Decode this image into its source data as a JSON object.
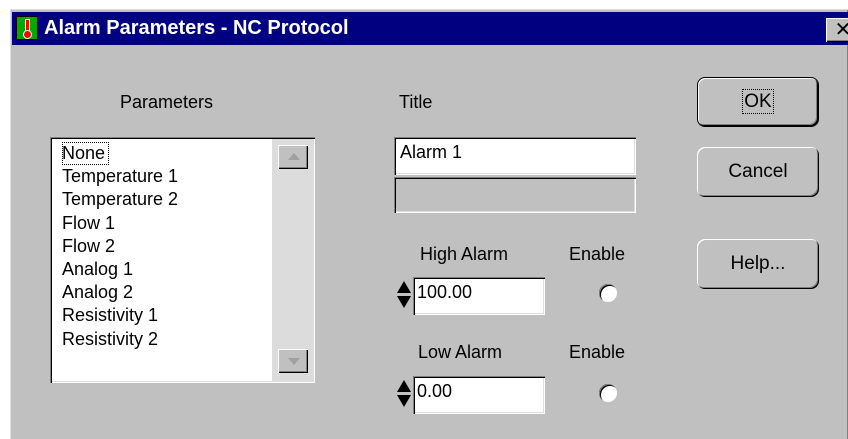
{
  "window": {
    "title": "Alarm Parameters - NC Protocol",
    "close_glyph": "✕"
  },
  "parameters": {
    "label": "Parameters",
    "items": [
      "None",
      "Temperature 1",
      "Temperature 2",
      "Flow 1",
      "Flow 2",
      "Analog 1",
      "Analog 2",
      "Resistivity 1",
      "Resistivity 2"
    ],
    "selected": "None"
  },
  "title_section": {
    "label": "Title",
    "value": "Alarm 1",
    "secondary_value": ""
  },
  "high_alarm": {
    "label": "High Alarm",
    "value": "100.00",
    "enable_label": "Enable",
    "enabled": false
  },
  "low_alarm": {
    "label": "Low Alarm",
    "value": "0.00",
    "enable_label": "Enable",
    "enabled": false
  },
  "buttons": {
    "ok_label": "OK",
    "cancel_label": "Cancel",
    "help_label": "Help..."
  },
  "icons": {
    "title": "thermometer-icon",
    "close": "close-icon",
    "scroll_up": "scroll-up-arrow-icon",
    "scroll_down": "scroll-down-arrow-icon",
    "spin": "spin-arrows-icon"
  },
  "colors": {
    "titlebar": "#000080",
    "dialog_bg": "#c0c0c0",
    "icon_green": "#00a800",
    "icon_red": "#ff0000"
  }
}
